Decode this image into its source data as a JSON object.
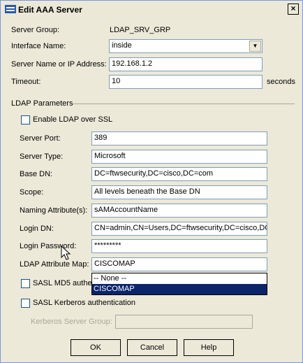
{
  "window": {
    "title": "Edit AAA Server",
    "close_glyph": "×"
  },
  "server_group": {
    "label": "Server Group:",
    "value": "LDAP_SRV_GRP"
  },
  "interface": {
    "label": "Interface Name:",
    "value": "inside"
  },
  "server_name": {
    "label": "Server Name or IP Address:",
    "value": "192.168.1.2"
  },
  "timeout": {
    "label": "Timeout:",
    "value": "10",
    "unit": "seconds"
  },
  "ldap": {
    "section_label": "LDAP Parameters",
    "enable_ssl_label": "Enable LDAP over SSL",
    "server_port": {
      "label": "Server Port:",
      "value": "389"
    },
    "server_type": {
      "label": "Server Type:",
      "value": "Microsoft"
    },
    "base_dn": {
      "label": "Base DN:",
      "value": "DC=ftwsecurity,DC=cisco,DC=com"
    },
    "scope": {
      "label": "Scope:",
      "value": "All levels beneath the Base DN"
    },
    "naming_attribute": {
      "label": "Naming Attribute(s):",
      "value": "sAMAccountName"
    },
    "login_dn": {
      "label": "Login DN:",
      "value": "CN=admin,CN=Users,DC=ftwsecurity,DC=cisco,DC"
    },
    "login_password": {
      "label": "Login Password:",
      "value": "*********"
    },
    "attribute_map": {
      "label": "LDAP Attribute Map:",
      "value": "CISCOMAP",
      "options": [
        "-- None --",
        "CISCOMAP"
      ],
      "selected_index": 1
    },
    "sasl_md5_label": "SASL MD5 authen",
    "sasl_kerberos_label": "SASL Kerberos authentication",
    "kerberos_group": {
      "label": "Kerberos Server Group:",
      "value": ""
    }
  },
  "buttons": {
    "ok": "OK",
    "cancel": "Cancel",
    "help": "Help"
  },
  "colors": {
    "dialog_bg": "#ece9d8",
    "selection": "#0a246a",
    "field_border": "#7f9db9"
  }
}
